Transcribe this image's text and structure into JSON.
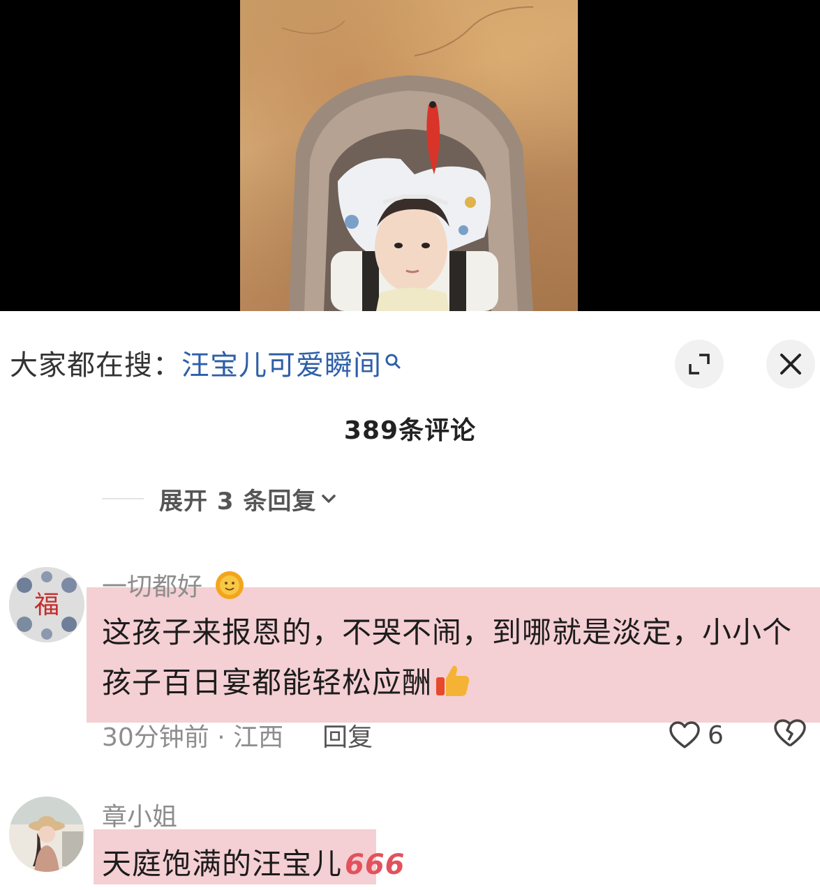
{
  "search": {
    "prefix": "大家都在搜：",
    "keyword": "汪宝儿可爱瞬间"
  },
  "comments_header": {
    "count_label": "389条评论",
    "expand_label": "展开 3 条回复"
  },
  "comments": [
    {
      "username": "一切都好",
      "text": "这孩子来报恩的，不哭不闹，到哪就是淡定，小小个孩子百日宴都能轻松应酬",
      "time_location": "30分钟前 · 江西",
      "reply_label": "回复",
      "likes": "6",
      "avatar_text": "福"
    },
    {
      "username": "章小姐",
      "text": "天庭饱满的汪宝儿",
      "sticker_text": "666"
    }
  ],
  "icons": {
    "search": "search-icon",
    "expand": "expand-icon",
    "close": "close-icon",
    "chevron": "chevron-down-icon",
    "like": "heart-icon",
    "dislike": "broken-heart-icon",
    "sun_emoji": "sun-emoji-icon",
    "thumbs_emoji": "thumbs-up-emoji-icon"
  },
  "colors": {
    "keyword": "#2d5fa8",
    "highlight": "#eeb6bc"
  }
}
